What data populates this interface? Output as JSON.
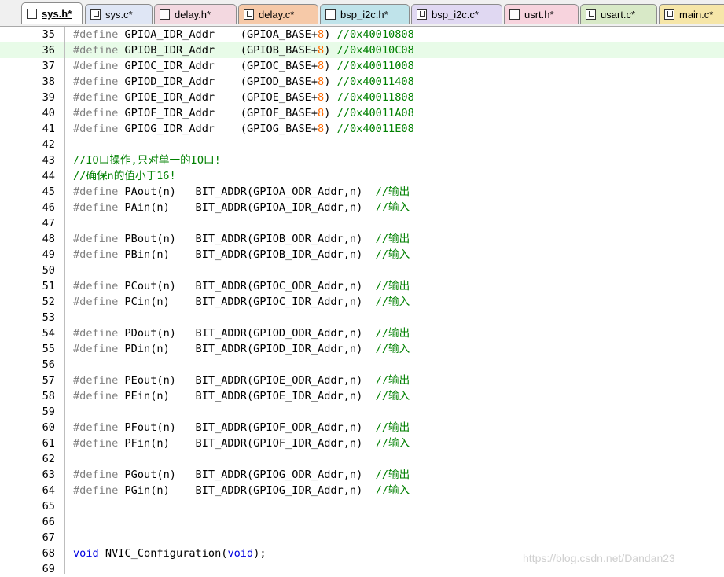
{
  "tabs": [
    {
      "label": "sys.h*",
      "type": "h",
      "color": "#ffffff",
      "active": true
    },
    {
      "label": "sys.c*",
      "type": "c",
      "color": "#dfe6f5",
      "active": false
    },
    {
      "label": "delay.h*",
      "type": "h",
      "color": "#f3d8e0",
      "active": false
    },
    {
      "label": "delay.c*",
      "type": "c",
      "color": "#f6c9a8",
      "active": false
    },
    {
      "label": "bsp_i2c.h*",
      "type": "h",
      "color": "#bfe3ea",
      "active": false
    },
    {
      "label": "bsp_i2c.c*",
      "type": "c",
      "color": "#e0d8f2",
      "active": false
    },
    {
      "label": "usrt.h*",
      "type": "h",
      "color": "#f7d3dd",
      "active": false
    },
    {
      "label": "usart.c*",
      "type": "c",
      "color": "#d8e9c7",
      "active": false
    },
    {
      "label": "main.c*",
      "type": "c",
      "color": "#f6e6a8",
      "active": false
    }
  ],
  "editor": {
    "highlighted_line": 36,
    "lines": [
      {
        "num": "35",
        "segs": [
          [
            "#define",
            "pp"
          ],
          [
            " GPIOA_IDR_Addr    (GPIOA_BASE+",
            ""
          ],
          [
            "8",
            "num"
          ],
          [
            ") ",
            ""
          ],
          [
            "//0x40010808",
            "cm"
          ]
        ]
      },
      {
        "num": "36",
        "segs": [
          [
            "#define",
            "pp"
          ],
          [
            " GPIOB_IDR_Addr    (GPIOB_BASE+",
            ""
          ],
          [
            "8",
            "num"
          ],
          [
            ") ",
            ""
          ],
          [
            "//0x40010C08",
            "cm"
          ]
        ]
      },
      {
        "num": "37",
        "segs": [
          [
            "#define",
            "pp"
          ],
          [
            " GPIOC_IDR_Addr    (GPIOC_BASE+",
            ""
          ],
          [
            "8",
            "num"
          ],
          [
            ") ",
            ""
          ],
          [
            "//0x40011008",
            "cm"
          ]
        ]
      },
      {
        "num": "38",
        "segs": [
          [
            "#define",
            "pp"
          ],
          [
            " GPIOD_IDR_Addr    (GPIOD_BASE+",
            ""
          ],
          [
            "8",
            "num"
          ],
          [
            ") ",
            ""
          ],
          [
            "//0x40011408",
            "cm"
          ]
        ]
      },
      {
        "num": "39",
        "segs": [
          [
            "#define",
            "pp"
          ],
          [
            " GPIOE_IDR_Addr    (GPIOE_BASE+",
            ""
          ],
          [
            "8",
            "num"
          ],
          [
            ") ",
            ""
          ],
          [
            "//0x40011808",
            "cm"
          ]
        ]
      },
      {
        "num": "40",
        "segs": [
          [
            "#define",
            "pp"
          ],
          [
            " GPIOF_IDR_Addr    (GPIOF_BASE+",
            ""
          ],
          [
            "8",
            "num"
          ],
          [
            ") ",
            ""
          ],
          [
            "//0x40011A08",
            "cm"
          ]
        ]
      },
      {
        "num": "41",
        "segs": [
          [
            "#define",
            "pp"
          ],
          [
            " GPIOG_IDR_Addr    (GPIOG_BASE+",
            ""
          ],
          [
            "8",
            "num"
          ],
          [
            ") ",
            ""
          ],
          [
            "//0x40011E08",
            "cm"
          ]
        ]
      },
      {
        "num": "42",
        "segs": []
      },
      {
        "num": "43",
        "segs": [
          [
            "//IO口操作,只对单一的IO口!",
            "cm"
          ]
        ]
      },
      {
        "num": "44",
        "segs": [
          [
            "//确保n的值小于16!",
            "cm"
          ]
        ]
      },
      {
        "num": "45",
        "segs": [
          [
            "#define",
            "pp"
          ],
          [
            " PAout(n)   BIT_ADDR(GPIOA_ODR_Addr,n)  ",
            ""
          ],
          [
            "//输出",
            "cm"
          ]
        ]
      },
      {
        "num": "46",
        "segs": [
          [
            "#define",
            "pp"
          ],
          [
            " PAin(n)    BIT_ADDR(GPIOA_IDR_Addr,n)  ",
            ""
          ],
          [
            "//输入",
            "cm"
          ]
        ]
      },
      {
        "num": "47",
        "segs": []
      },
      {
        "num": "48",
        "segs": [
          [
            "#define",
            "pp"
          ],
          [
            " PBout(n)   BIT_ADDR(GPIOB_ODR_Addr,n)  ",
            ""
          ],
          [
            "//输出",
            "cm"
          ]
        ]
      },
      {
        "num": "49",
        "segs": [
          [
            "#define",
            "pp"
          ],
          [
            " PBin(n)    BIT_ADDR(GPIOB_IDR_Addr,n)  ",
            ""
          ],
          [
            "//输入",
            "cm"
          ]
        ]
      },
      {
        "num": "50",
        "segs": []
      },
      {
        "num": "51",
        "segs": [
          [
            "#define",
            "pp"
          ],
          [
            " PCout(n)   BIT_ADDR(GPIOC_ODR_Addr,n)  ",
            ""
          ],
          [
            "//输出",
            "cm"
          ]
        ]
      },
      {
        "num": "52",
        "segs": [
          [
            "#define",
            "pp"
          ],
          [
            " PCin(n)    BIT_ADDR(GPIOC_IDR_Addr,n)  ",
            ""
          ],
          [
            "//输入",
            "cm"
          ]
        ]
      },
      {
        "num": "53",
        "segs": []
      },
      {
        "num": "54",
        "segs": [
          [
            "#define",
            "pp"
          ],
          [
            " PDout(n)   BIT_ADDR(GPIOD_ODR_Addr,n)  ",
            ""
          ],
          [
            "//输出",
            "cm"
          ]
        ]
      },
      {
        "num": "55",
        "segs": [
          [
            "#define",
            "pp"
          ],
          [
            " PDin(n)    BIT_ADDR(GPIOD_IDR_Addr,n)  ",
            ""
          ],
          [
            "//输入",
            "cm"
          ]
        ]
      },
      {
        "num": "56",
        "segs": []
      },
      {
        "num": "57",
        "segs": [
          [
            "#define",
            "pp"
          ],
          [
            " PEout(n)   BIT_ADDR(GPIOE_ODR_Addr,n)  ",
            ""
          ],
          [
            "//输出",
            "cm"
          ]
        ]
      },
      {
        "num": "58",
        "segs": [
          [
            "#define",
            "pp"
          ],
          [
            " PEin(n)    BIT_ADDR(GPIOE_IDR_Addr,n)  ",
            ""
          ],
          [
            "//输入",
            "cm"
          ]
        ]
      },
      {
        "num": "59",
        "segs": []
      },
      {
        "num": "60",
        "segs": [
          [
            "#define",
            "pp"
          ],
          [
            " PFout(n)   BIT_ADDR(GPIOF_ODR_Addr,n)  ",
            ""
          ],
          [
            "//输出",
            "cm"
          ]
        ]
      },
      {
        "num": "61",
        "segs": [
          [
            "#define",
            "pp"
          ],
          [
            " PFin(n)    BIT_ADDR(GPIOF_IDR_Addr,n)  ",
            ""
          ],
          [
            "//输入",
            "cm"
          ]
        ]
      },
      {
        "num": "62",
        "segs": []
      },
      {
        "num": "63",
        "segs": [
          [
            "#define",
            "pp"
          ],
          [
            " PGout(n)   BIT_ADDR(GPIOG_ODR_Addr,n)  ",
            ""
          ],
          [
            "//输出",
            "cm"
          ]
        ]
      },
      {
        "num": "64",
        "segs": [
          [
            "#define",
            "pp"
          ],
          [
            " PGin(n)    BIT_ADDR(GPIOG_IDR_Addr,n)  ",
            ""
          ],
          [
            "//输入",
            "cm"
          ]
        ]
      },
      {
        "num": "65",
        "segs": []
      },
      {
        "num": "66",
        "segs": []
      },
      {
        "num": "67",
        "segs": []
      },
      {
        "num": "68",
        "segs": [
          [
            "void",
            "kw"
          ],
          [
            " NVIC_Configuration(",
            ""
          ],
          [
            "void",
            "kw"
          ],
          [
            ");",
            ""
          ]
        ]
      },
      {
        "num": "69",
        "segs": []
      }
    ]
  },
  "watermark": "https://blog.csdn.net/Dandan23___"
}
